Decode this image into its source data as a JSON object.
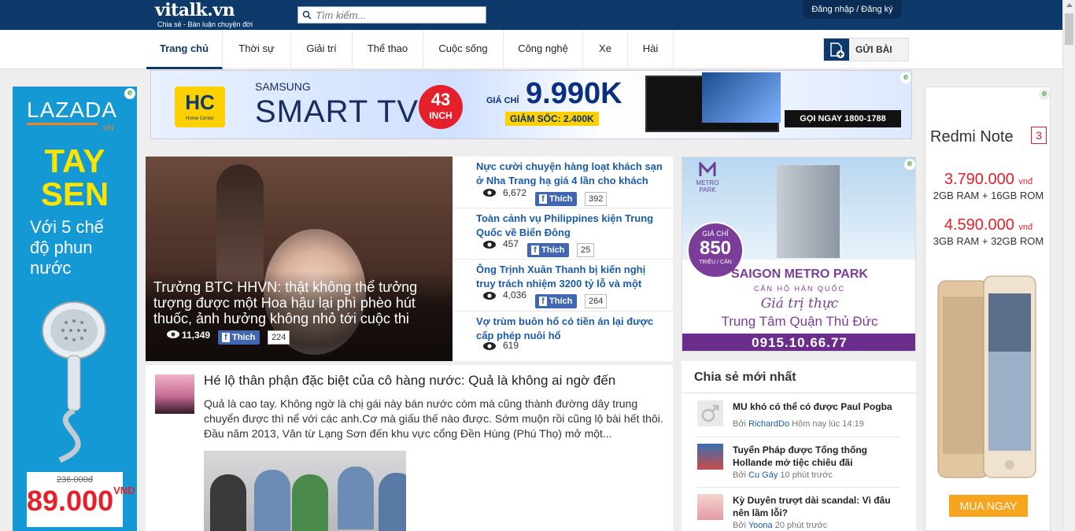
{
  "header": {
    "logo": "vitalk.vn",
    "tagline": "Chia sẻ - Bàn luận chuyện đời",
    "search_placeholder": "Tìm kiếm...",
    "login": "Đăng nhập / Đăng ký"
  },
  "nav": {
    "items": [
      {
        "label": "Trang chủ"
      },
      {
        "label": "Thời sự"
      },
      {
        "label": "Giải trí"
      },
      {
        "label": "Thể thao"
      },
      {
        "label": "Cuộc sống"
      },
      {
        "label": "Công nghệ"
      },
      {
        "label": "Xe"
      },
      {
        "label": "Hài"
      }
    ],
    "post_button": "GỬI BÀI"
  },
  "top_banner": {
    "hc_logo": "HC",
    "hc_sub": "Home Center",
    "samsung": "SAMSUNG",
    "smart_tv": "SMART TV",
    "inch_num": "43",
    "inch_unit": "INCH",
    "price_prefix": "GIÁ CHỈ",
    "price": "9.990K",
    "discount": "GIẢM SỐC: 2.400K",
    "call": "GỌI NGAY 1800-1788"
  },
  "left_ad": {
    "brand": "LAZADA",
    "brand_suffix": ".VN",
    "title1": "TAY",
    "title2": "SEN",
    "desc": "Với 5 chế độ phun nước",
    "old_price": "236.000đ",
    "new_price": "89.000",
    "currency": "VND"
  },
  "right_ad": {
    "model": "Redmi Note",
    "model_num": "3",
    "price1": "3.790.000",
    "price1_unit": "vnđ",
    "spec1": "2GB RAM + 16GB ROM",
    "price2": "4.590.000",
    "price2_unit": "vnđ",
    "spec2": "3GB RAM + 32GB ROM",
    "buy": "MUA NGAY"
  },
  "featured": {
    "title": "Trưởng BTC HHVN: thật không thể tưởng tượng được một Hoa hậu lại phì phèo hút thuốc, ảnh hưởng không nhỏ tới cuộc thi",
    "views": "11,349",
    "like_label": "Thích",
    "like_count": "224"
  },
  "news": [
    {
      "title": "Nực cười chuyện hàng loạt khách sạn ở Nha Trang hạ giá 4 lần cho khách",
      "views": "6,672",
      "like_label": "Thích",
      "likes": "392"
    },
    {
      "title": "Toàn cảnh vụ Philippines kiện Trung Quốc về Biển Đông",
      "views": "457",
      "like_label": "Thích",
      "likes": "25"
    },
    {
      "title": "Ông Trịnh Xuân Thanh bị kiến nghị truy trách nhiệm 3200 tỷ lỗ và một",
      "views": "4,036",
      "like_label": "Thích",
      "likes": "264"
    },
    {
      "title": "Vợ trùm buôn hổ có tiền án lại được cấp phép nuôi hổ",
      "views": "619"
    }
  ],
  "metro_ad": {
    "logo": "METRO PARK",
    "price_pre": "GIÁ CHỈ",
    "price": "850",
    "price_unit": "TRIỆU / CĂN",
    "name": "SAIGON METRO PARK",
    "sub": "CĂN HỘ HÀN QUỐC",
    "slogan": "Giá trị thực",
    "location": "Trung Tâm Quận Thủ Đức",
    "phone": "0915.10.66.77"
  },
  "article": {
    "title": "Hé lộ thân phận đặc biệt của cô hàng nước: Quả là không ai ngờ đến",
    "excerpt": "Quả là cao tay. Không ngờ là chị gái này bán nước còm mà cũng thành đường dây trung chuyển được thì nể với các anh.Cơ mà giấu thế nào được. Sớm muộn rồi cũng lộ bài hết thôi. Đầu năm 2013, Vân từ Lạng Sơn đến khu vực cổng Đền Hùng (Phú Thọ) mở một..."
  },
  "latest": {
    "title": "Chia sẻ mới nhất",
    "items": [
      {
        "text": "MU khó có thể có được Paul Pogba",
        "by": "Bởi",
        "author": "RichardDo",
        "time": "Hôm nay lúc 14:19"
      },
      {
        "text": "Tuyển Pháp được Tổng thống Hollande mở tiệc chiêu đãi",
        "by": "Bởi",
        "author": "Cu Gáy",
        "time": "10 phút trước"
      },
      {
        "text": "Kỳ Duyên trượt dài scandal: Vì đâu nên lầm lỗi?",
        "by": "Bởi",
        "author": "Yoona",
        "time": "20 phút trước"
      }
    ]
  },
  "colors": {
    "header_bg": "#0d3a6b",
    "link_blue": "#1b5ba8",
    "fb_blue": "#4267b2"
  }
}
